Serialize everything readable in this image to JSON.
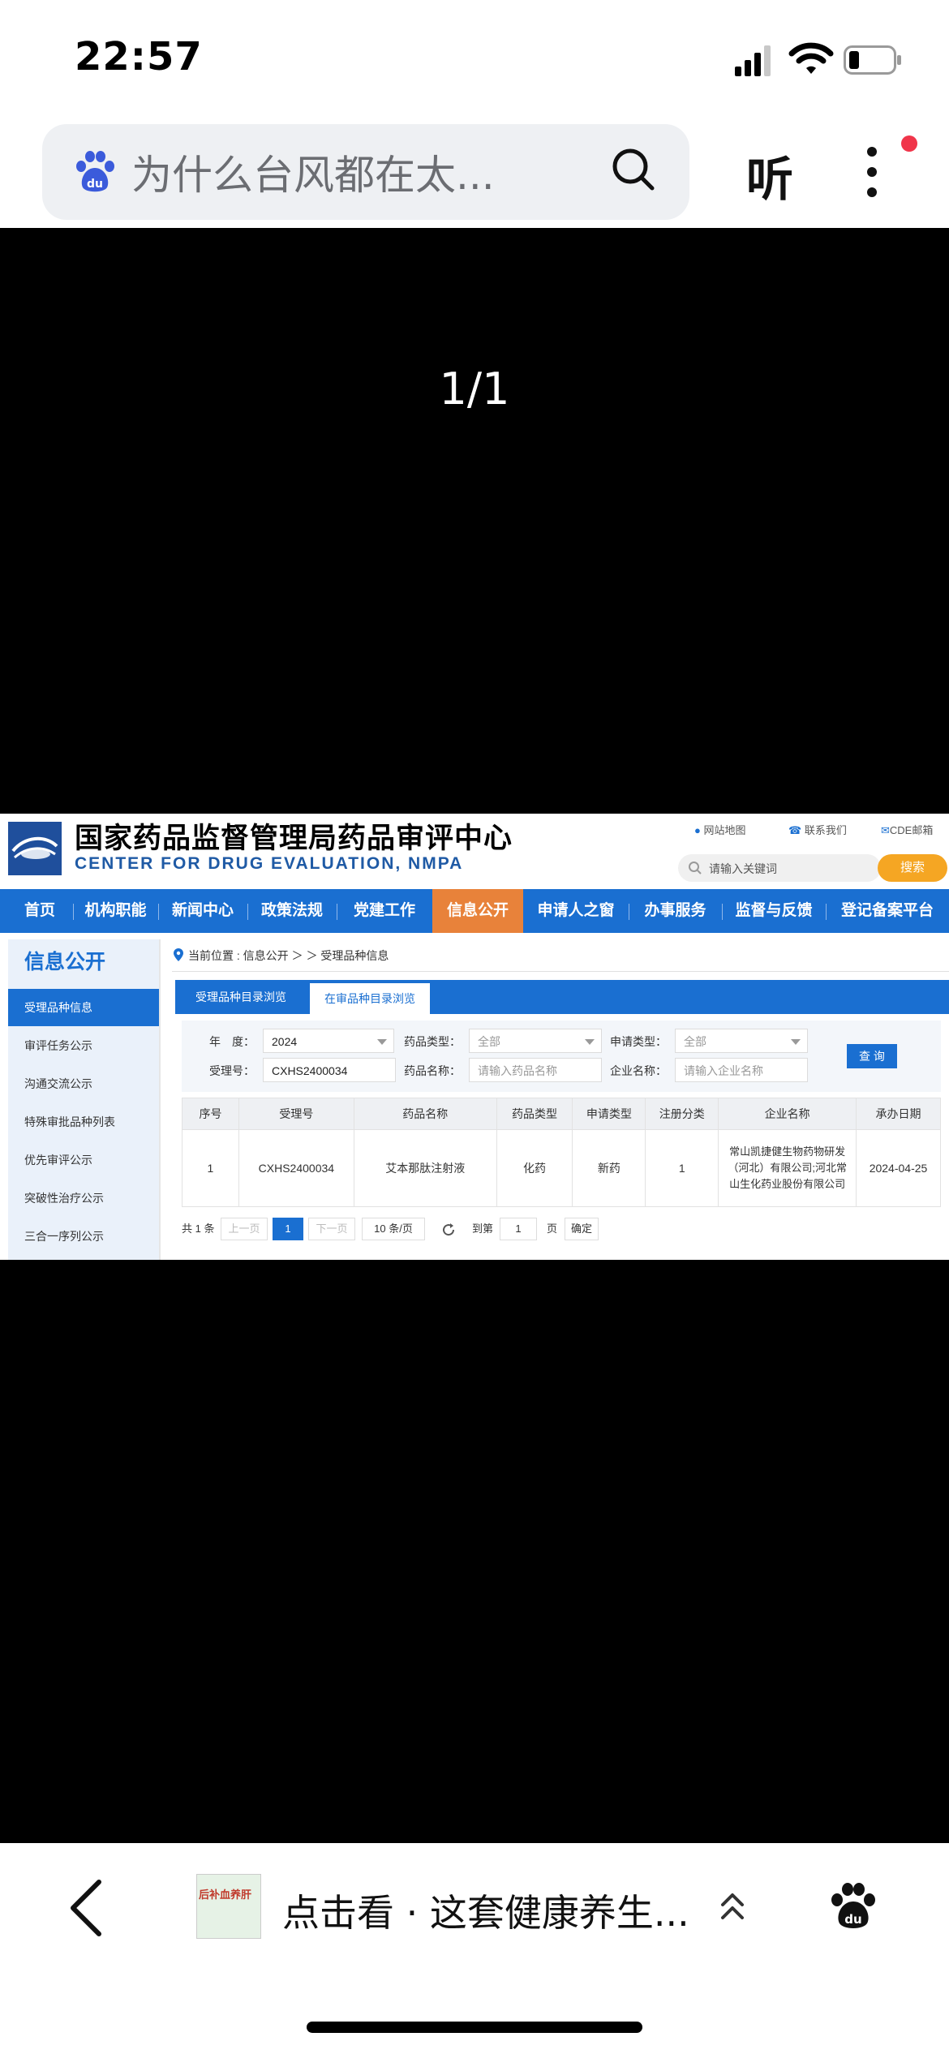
{
  "status_bar": {
    "time": "22:57"
  },
  "search_bar": {
    "query": "为什么台风都在太...",
    "listen_label": "听"
  },
  "viewer": {
    "page_indicator": "1/1"
  },
  "cde": {
    "title_cn": "国家药品监督管理局药品审评中心",
    "title_en": "CENTER FOR DRUG EVALUATION, NMPA",
    "top_links": [
      "网站地图",
      "联系我们",
      "CDE邮箱"
    ],
    "keyword_placeholder": "请输入关键词",
    "search_label": "搜索",
    "nav": [
      "首页",
      "机构职能",
      "新闻中心",
      "政策法规",
      "党建工作",
      "信息公开",
      "申请人之窗",
      "办事服务",
      "监督与反馈",
      "登记备案平台"
    ],
    "sidebar": {
      "heading": "信息公开",
      "items": [
        "受理品种信息",
        "审评任务公示",
        "沟通交流公示",
        "特殊审批品种列表",
        "优先审评公示",
        "突破性治疗公示",
        "三合一序列公示"
      ]
    },
    "breadcrumb": "当前位置 : 信息公开 ＞ ＞ 受理品种信息",
    "tabs": [
      "受理品种目录浏览",
      "在审品种目录浏览"
    ],
    "form": {
      "year_label": "年　度：",
      "year_value": "2024",
      "drug_type_label": "药品类型：",
      "drug_type_value": "全部",
      "apply_type_label": "申请类型：",
      "apply_type_value": "全部",
      "accept_no_label": "受理号：",
      "accept_no_value": "CXHS2400034",
      "drug_name_label": "药品名称：",
      "drug_name_placeholder": "请输入药品名称",
      "company_label": "企业名称：",
      "company_placeholder": "请输入企业名称",
      "query_label": "查 询"
    },
    "table": {
      "headers": [
        "序号",
        "受理号",
        "药品名称",
        "药品类型",
        "申请类型",
        "注册分类",
        "企业名称",
        "承办日期"
      ],
      "rows": [
        [
          "1",
          "CXHS2400034",
          "艾本那肽注射液",
          "化药",
          "新药",
          "1",
          "常山凯捷健生物药物研发（河北）有限公司;河北常山生化药业股份有限公司",
          "2024-04-25"
        ]
      ]
    },
    "pagination": {
      "total": "共 1 条",
      "prev": "上一页",
      "page": "1",
      "next": "下一页",
      "page_size": "10 条/页",
      "goto": "到第",
      "goto_value": "1",
      "page_unit": "页",
      "confirm": "确定"
    }
  },
  "bottom_bar": {
    "title": "点击看 · 这套健康养生...",
    "thumb_text": "后补血养肝"
  }
}
